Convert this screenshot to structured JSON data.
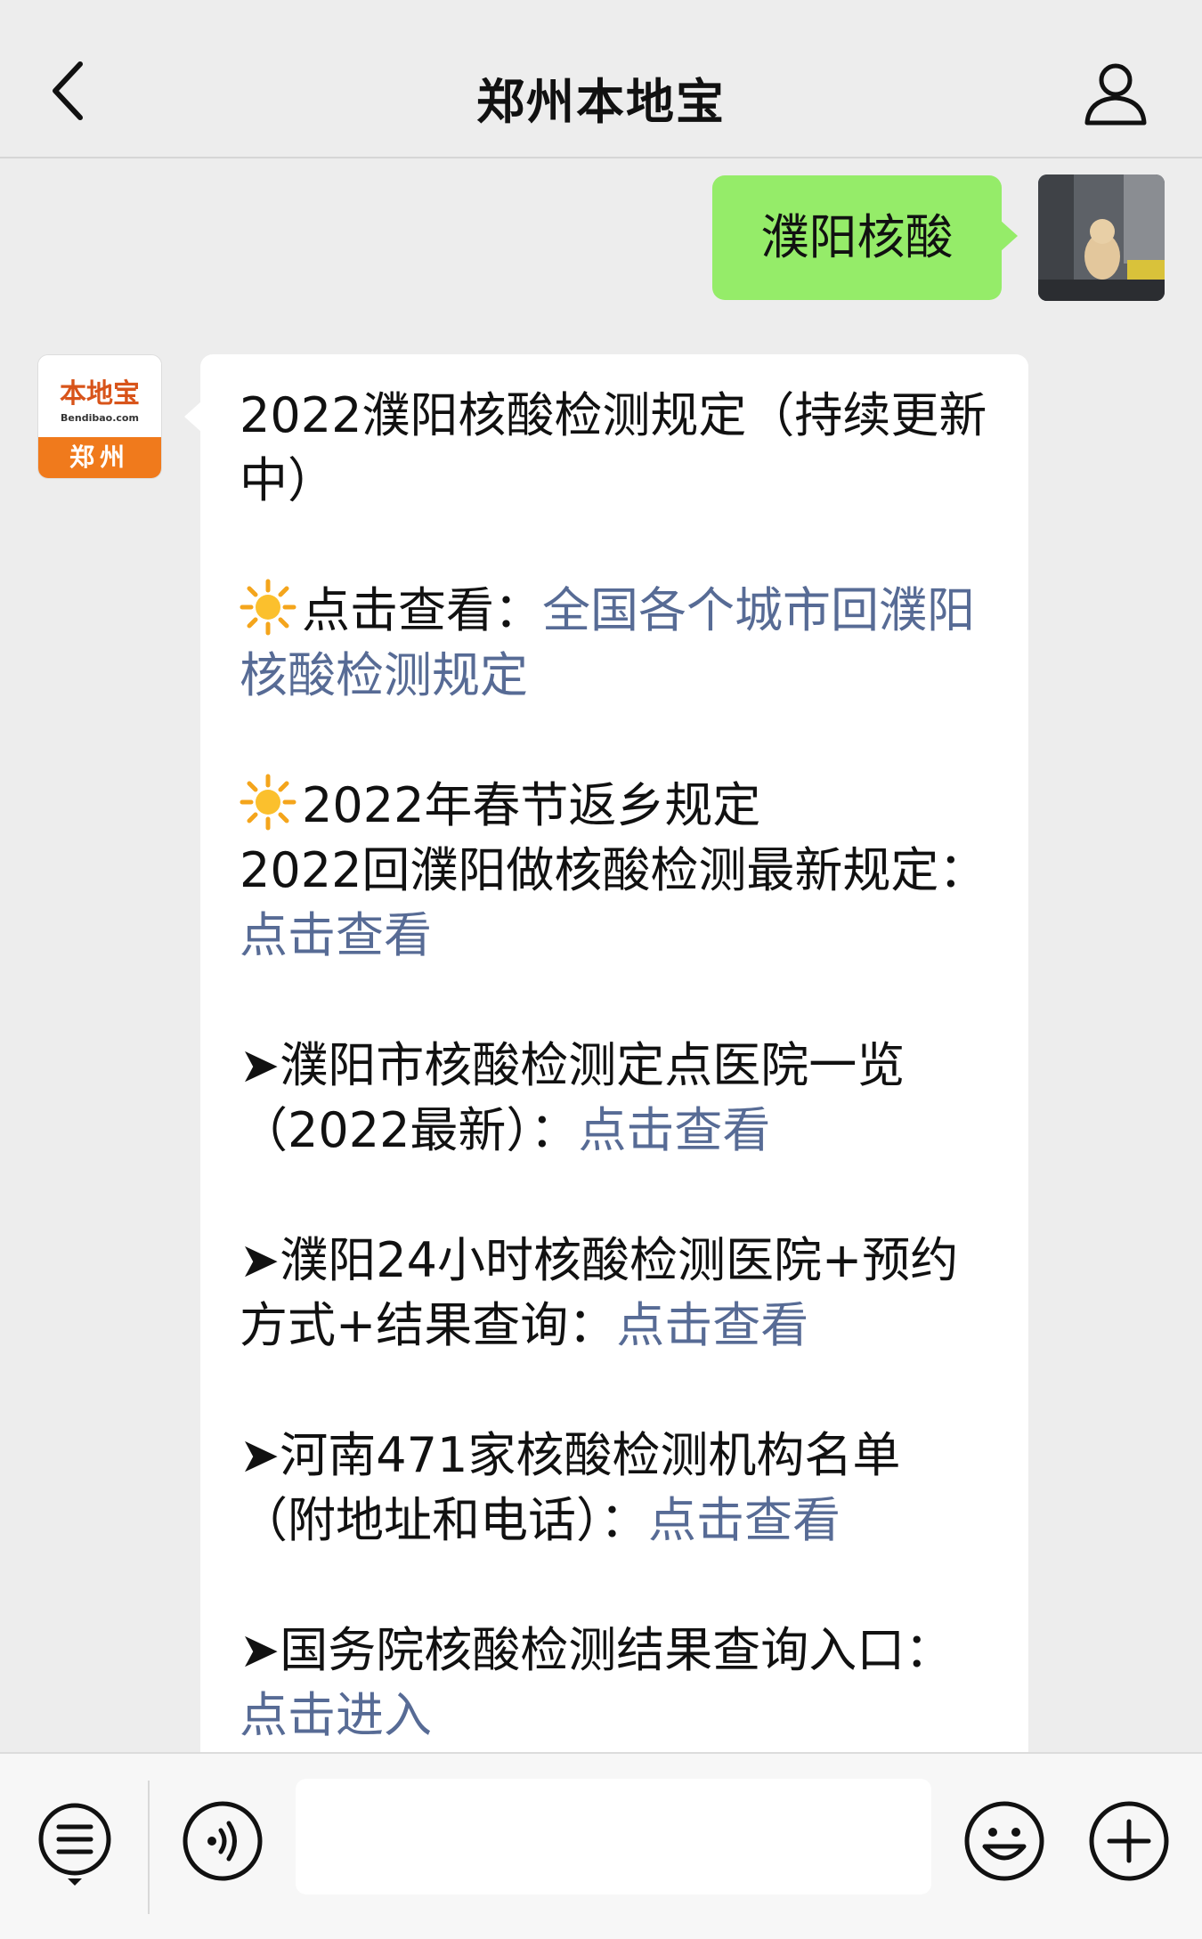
{
  "header": {
    "title": "郑州本地宝"
  },
  "outgoing_message": {
    "text": "濮阳核酸"
  },
  "bot_avatar": {
    "brand": "本地宝",
    "domain": "Bendibao.com",
    "city": "郑州"
  },
  "incoming_message": {
    "title": "2022濮阳核酸检测规定（持续更新中）",
    "p1": {
      "prefix": "点击查看：",
      "link": "全国各个城市回濮阳核酸检测规定"
    },
    "p2": {
      "line1": "2022年春节返乡规定",
      "line2": "2022回濮阳做核酸检测最新规定：",
      "link": "点击查看"
    },
    "p3": {
      "text": "➤濮阳市核酸检测定点医院一览（2022最新）：",
      "link": "点击查看"
    },
    "p4": {
      "text": "➤濮阳24小时核酸检测医院+预约方式+结果查询：",
      "link": "点击查看"
    },
    "p5": {
      "text": "➤河南471家核酸检测机构名单（附地址和电话）：",
      "link": "点击查看"
    },
    "p6": {
      "text": "➤国务院核酸检测结果查询入口：",
      "link": "点击进入"
    }
  },
  "icons": {
    "back": "chevron-left-icon",
    "profile": "person-icon",
    "menu": "list-menu-icon",
    "voice": "voice-icon",
    "emoji": "smiley-icon",
    "plus": "plus-icon"
  },
  "colors": {
    "background": "#ededed",
    "outgoing_bubble": "#95ec69",
    "link": "#576b95",
    "brand_orange": "#f07a1c"
  }
}
